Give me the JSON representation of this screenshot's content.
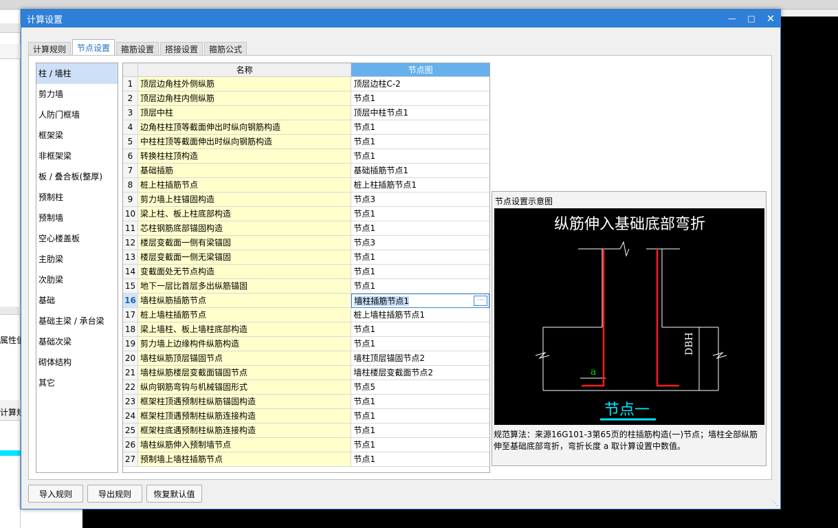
{
  "dialog": {
    "title": "计算设置"
  },
  "background": {
    "texts": [
      "属性值",
      "计算规"
    ]
  },
  "tabs": [
    "计算规则",
    "节点设置",
    "箍筋设置",
    "搭接设置",
    "箍筋公式"
  ],
  "categories": [
    "柱 / 墙柱",
    "剪力墙",
    "人防门框墙",
    "框架梁",
    "非框架梁",
    "板 / 叠合板(整厚)",
    "预制柱",
    "预制墙",
    "空心楼盖板",
    "主肋梁",
    "次肋梁",
    "基础",
    "基础主梁 / 承台梁",
    "基础次梁",
    "砌体结构",
    "其它"
  ],
  "grid": {
    "headers": [
      "名称",
      "节点图"
    ],
    "rows": [
      {
        "no": "1",
        "name": "顶层边角柱外侧纵筋",
        "node": "顶层边柱C-2"
      },
      {
        "no": "2",
        "name": "顶层边角柱内侧纵筋",
        "node": "节点1"
      },
      {
        "no": "3",
        "name": "顶层中柱",
        "node": "顶层中柱节点1"
      },
      {
        "no": "4",
        "name": "边角柱柱顶等截面伸出时纵向钢筋构造",
        "node": "节点1"
      },
      {
        "no": "5",
        "name": "中柱柱顶等截面伸出时纵向钢筋构造",
        "node": "节点1"
      },
      {
        "no": "6",
        "name": "转换柱柱顶构造",
        "node": "节点1"
      },
      {
        "no": "7",
        "name": "基础插筋",
        "node": "基础插筋节点1"
      },
      {
        "no": "8",
        "name": "桩上柱插筋节点",
        "node": "桩上柱插筋节点1"
      },
      {
        "no": "9",
        "name": "剪力墙上柱锚固构造",
        "node": "节点3"
      },
      {
        "no": "10",
        "name": "梁上柱、板上柱底部构造",
        "node": "节点1"
      },
      {
        "no": "11",
        "name": "芯柱钢筋底部锚固构造",
        "node": "节点1"
      },
      {
        "no": "12",
        "name": "楼层变截面一侧有梁锚固",
        "node": "节点3"
      },
      {
        "no": "13",
        "name": "楼层变截面一侧无梁锚固",
        "node": "节点1"
      },
      {
        "no": "14",
        "name": "变截面处无节点构造",
        "node": "节点1"
      },
      {
        "no": "15",
        "name": "地下一层比首层多出纵筋锚固",
        "node": "节点1"
      },
      {
        "no": "16",
        "name": "墙柱纵筋插筋节点",
        "node": "墙柱插筋节点1"
      },
      {
        "no": "17",
        "name": "桩上墙柱插筋节点",
        "node": "桩上墙柱插筋节点1"
      },
      {
        "no": "18",
        "name": "梁上墙柱、板上墙柱底部构造",
        "node": "节点1"
      },
      {
        "no": "19",
        "name": "剪力墙上边缘构件纵筋构造",
        "node": "节点1"
      },
      {
        "no": "20",
        "name": "墙柱纵筋顶层锚固节点",
        "node": "墙柱顶层锚固节点2"
      },
      {
        "no": "21",
        "name": "墙柱纵筋楼层变截面锚固节点",
        "node": "墙柱楼层变截面节点2"
      },
      {
        "no": "22",
        "name": "纵向钢筋弯钩与机械锚固形式",
        "node": "节点5"
      },
      {
        "no": "23",
        "name": "框架柱顶遇预制柱纵筋锚固构造",
        "node": "节点1"
      },
      {
        "no": "24",
        "name": "框架柱顶遇预制柱纵筋连接构造",
        "node": "节点1"
      },
      {
        "no": "25",
        "name": "框架柱底遇预制柱纵筋连接构造",
        "node": "节点1"
      },
      {
        "no": "26",
        "name": "墙柱纵筋伸入预制墙节点",
        "node": "节点1"
      },
      {
        "no": "27",
        "name": "预制墙上墙柱插筋节点",
        "node": "节点1"
      }
    ]
  },
  "diagram": {
    "panel_title": "节点设置示意图",
    "heading": "纵筋伸入基础底部弯折",
    "dim_label": "DBH",
    "a_label": "a",
    "node_label": "节点一",
    "description": "规范算法：来源16G101-3第65页的柱插筋构造(一)节点；墙柱全部纵筋伸至基础底部弯折，弯折长度 a 取计算设置中数值。"
  },
  "buttons": [
    "导入规则",
    "导出规则",
    "恢复默认值"
  ],
  "colors": {
    "accent": "#2e7fd8",
    "header_selected": "#66b0ee",
    "name_cell": "#ffffcc",
    "rebar": "#ff1a1a",
    "label_green": "#00e000",
    "label_cyan": "#00e5ff"
  }
}
